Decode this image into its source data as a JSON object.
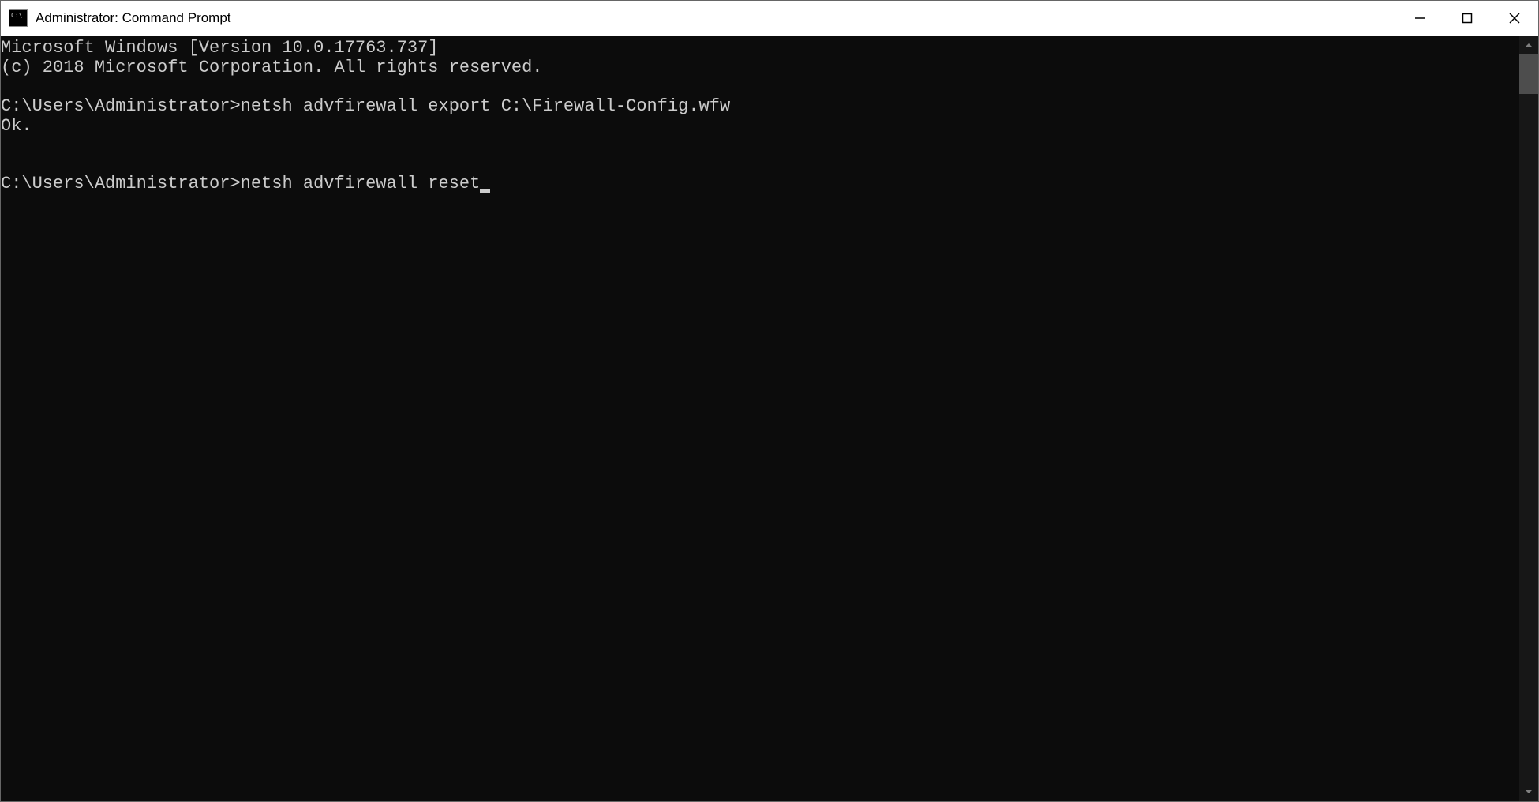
{
  "window": {
    "title": "Administrator: Command Prompt"
  },
  "terminal": {
    "lines": [
      "Microsoft Windows [Version 10.0.17763.737]",
      "(c) 2018 Microsoft Corporation. All rights reserved.",
      "",
      "C:\\Users\\Administrator>netsh advfirewall export C:\\Firewall-Config.wfw",
      "Ok.",
      "",
      ""
    ],
    "current_prompt": "C:\\Users\\Administrator>",
    "current_input": "netsh advfirewall reset"
  }
}
